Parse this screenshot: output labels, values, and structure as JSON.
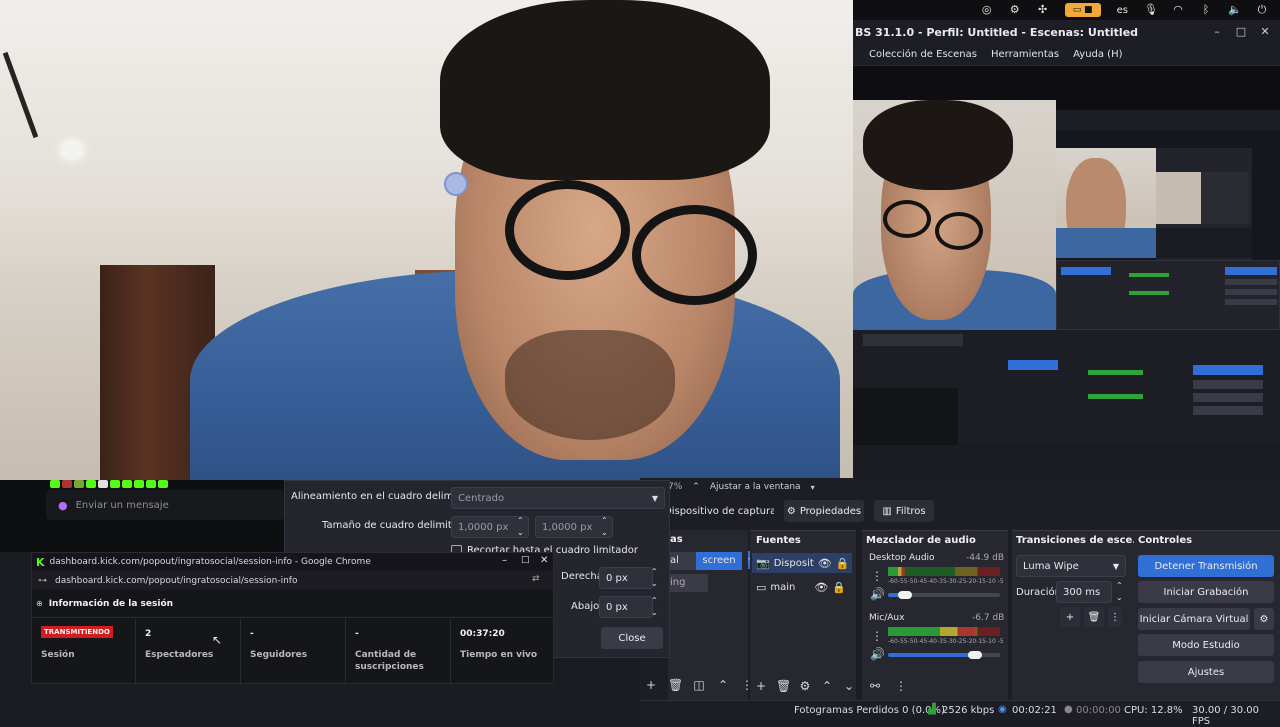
{
  "system_tray": {
    "keyboard_layout": "es"
  },
  "obs": {
    "title": "BS 31.1.0 - Perfil: Untitled - Escenas: Untitled",
    "menu": [
      "Colección de Escenas",
      "Herramientas",
      "Ayuda (H)"
    ],
    "zoom_bar": {
      "percent": "7%",
      "fit_label": "Ajustar a la ventana"
    },
    "source_toolbar": {
      "source_name": "Dispositivo de captura de v",
      "properties": "Propiedades",
      "filters": "Filtros"
    },
    "scenes": {
      "title": "as",
      "items": [
        "al",
        "ing"
      ],
      "screen_label": "screen"
    },
    "sources": {
      "title": "Fuentes",
      "items": [
        "Dispositi",
        "main"
      ]
    },
    "mixer": {
      "title": "Mezclador de audio",
      "channels": [
        {
          "name": "Desktop Audio",
          "db": "-44.9 dB",
          "level": 0.15
        },
        {
          "name": "Mic/Aux",
          "db": "-6.7 dB",
          "level": 0.78
        }
      ],
      "scale": "-60-55-50-45-40-35-30-25-20-15-10 -5 0"
    },
    "transitions": {
      "title": "Transiciones de esce...",
      "transition": "Luma Wipe",
      "duration_label": "Duración",
      "duration": "300 ms"
    },
    "controls": {
      "title": "Controles",
      "buttons": [
        "Detener Transmisión",
        "Iniciar Grabación",
        "Iniciar Cámara Virtual",
        "Modo Estudio",
        "Ajustes"
      ]
    },
    "status": {
      "dropped": "Fotogramas Perdidos 0 (0.0%)",
      "bitrate": "2526 kbps",
      "stream_time": "00:02:21",
      "rec_time": "00:00:00",
      "cpu": "CPU: 12.8%",
      "fps": "30.00 / 30.00 FPS"
    }
  },
  "properties_dialog": {
    "align_label": "Alineamiento en el cuadro delimitador",
    "align_value": "Centrado",
    "size_label": "Tamaño de cuadro delimitador",
    "size_w": "1,0000 px",
    "size_h": "1,0000 px",
    "crop_checkbox": "Recortar hasta el cuadro limitador",
    "right_label": "Derecha",
    "right_value": "0 px",
    "bottom_label": "Abajo",
    "bottom_value": "0 px",
    "close": "Close"
  },
  "chat": {
    "placeholder": "Enviar un mensaje"
  },
  "chrome_popup": {
    "title": "dashboard.kick.com/popout/ingratosocial/session-info - Google Chrome",
    "url": "dashboard.kick.com/popout/ingratosocial/session-info",
    "heading": "Información de la sesión",
    "stats": [
      {
        "value": "TRANSMITIENDO",
        "label": "Sesión"
      },
      {
        "value": "2",
        "label": "Espectadores"
      },
      {
        "value": "-",
        "label": "Seguidores"
      },
      {
        "value": "-",
        "label": "Cantidad de suscripciones"
      },
      {
        "value": "00:37:20",
        "label": "Tiempo en vivo"
      }
    ]
  },
  "colors": {
    "accent_blue": "#2f6fd6",
    "live_red": "#d11d1d",
    "kick_green": "#53fc18"
  }
}
